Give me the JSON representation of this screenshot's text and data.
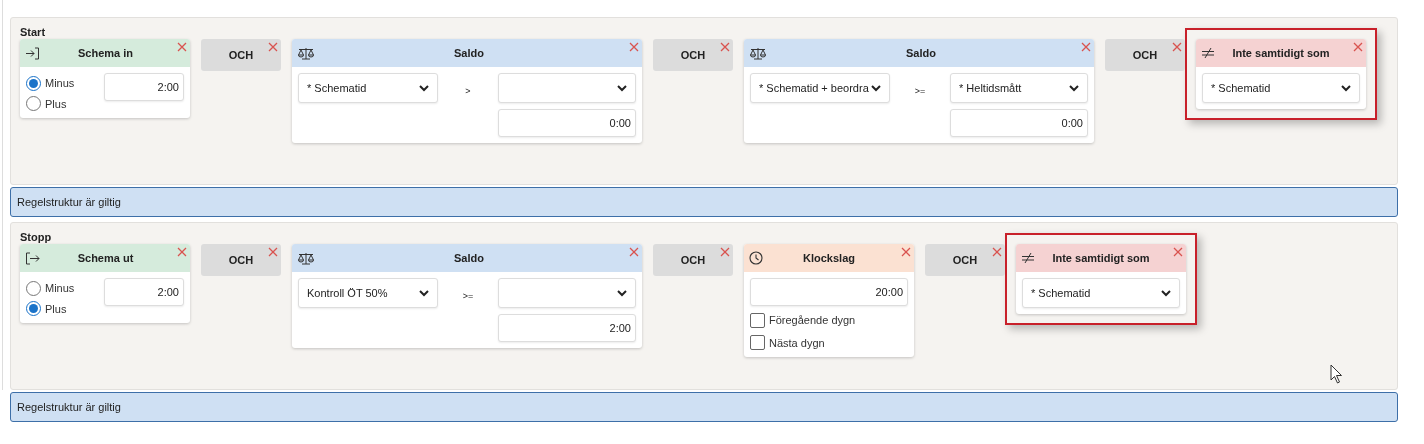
{
  "sections": [
    {
      "title": "Start",
      "status": "Regelstruktur är giltig",
      "blocks": [
        {
          "kind": "schema_in",
          "title": "Schema in",
          "options": [
            {
              "label": "Minus",
              "selected": true
            },
            {
              "label": "Plus",
              "selected": false
            }
          ],
          "value": "2:00"
        },
        {
          "kind": "and",
          "title": "OCH"
        },
        {
          "kind": "balance",
          "title": "Saldo",
          "left_select": "* Schematid",
          "operator": ">",
          "value": "0:00"
        },
        {
          "kind": "and",
          "title": "OCH"
        },
        {
          "kind": "balance",
          "title": "Saldo",
          "left_select": "* Schematid + beordra",
          "operator": ">=",
          "right_select": "* Heltidsmått",
          "value": "0:00"
        },
        {
          "kind": "and",
          "title": "OCH"
        },
        {
          "kind": "not_same",
          "title": "Inte samtidigt som",
          "select": "* Schematid",
          "highlighted": true
        }
      ]
    },
    {
      "title": "Stopp",
      "status": "Regelstruktur är giltig",
      "blocks": [
        {
          "kind": "schema_out",
          "title": "Schema ut",
          "options": [
            {
              "label": "Minus",
              "selected": false
            },
            {
              "label": "Plus",
              "selected": true
            }
          ],
          "value": "2:00"
        },
        {
          "kind": "and",
          "title": "OCH"
        },
        {
          "kind": "balance",
          "title": "Saldo",
          "left_select": "Kontroll ÖT 50%",
          "operator": ">=",
          "value": "2:00"
        },
        {
          "kind": "and",
          "title": "OCH"
        },
        {
          "kind": "clock",
          "title": "Klockslag",
          "value": "20:00",
          "checkboxes": [
            {
              "label": "Föregående dygn",
              "checked": false
            },
            {
              "label": "Nästa dygn",
              "checked": false
            }
          ]
        },
        {
          "kind": "and",
          "title": "OCH"
        },
        {
          "kind": "not_same",
          "title": "Inte samtidigt som",
          "select": "* Schematid",
          "highlighted": true
        }
      ]
    }
  ]
}
